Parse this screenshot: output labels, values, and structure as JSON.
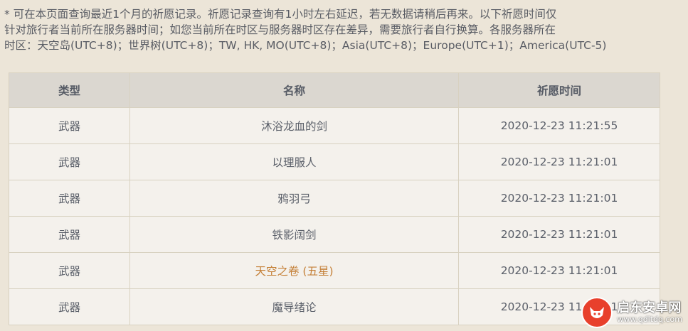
{
  "notice": {
    "lines": [
      "* 可在本页面查询最近1个月的祈愿记录。祈愿记录查询有1小时左右延迟，若无数据请稍后再来。以下祈愿时间仅",
      "针对旅行者当前所在服务器时间；如您当前所在时区与服务器时区存在差异，需要旅行者自行换算。各服务器所在",
      "时区：天空岛(UTC+8)；世界树(UTC+8)；TW, HK, MO(UTC+8)；Asia(UTC+8)；Europe(UTC+1)；America(UTC-5)"
    ]
  },
  "table": {
    "headers": {
      "type": "类型",
      "name": "名称",
      "time": "祈愿时间"
    },
    "rows": [
      {
        "type": "武器",
        "name": "沐浴龙血的剑",
        "time": "2020-12-23 11:21:55"
      },
      {
        "type": "武器",
        "name": "以理服人",
        "time": "2020-12-23 11:21:01"
      },
      {
        "type": "武器",
        "name": "鸦羽弓",
        "time": "2020-12-23 11:21:01"
      },
      {
        "type": "武器",
        "name": "铁影阔剑",
        "time": "2020-12-23 11:21:01"
      },
      {
        "type": "武器",
        "name": "天空之卷 (五星)",
        "time": "2020-12-23 11:21:01"
      },
      {
        "type": "武器",
        "name": "魔导绪论",
        "time": "2020-12-23 11:21:01"
      }
    ]
  },
  "colors": {
    "background": "#ece5d8",
    "header_bg": "#dbd7d0",
    "cell_bg": "#f4f1ec",
    "five_star": "#c47f36"
  },
  "watermark": {
    "name": "启东安卓网",
    "url": "www.qdltdq.com",
    "icon": "fox-logo-icon"
  }
}
